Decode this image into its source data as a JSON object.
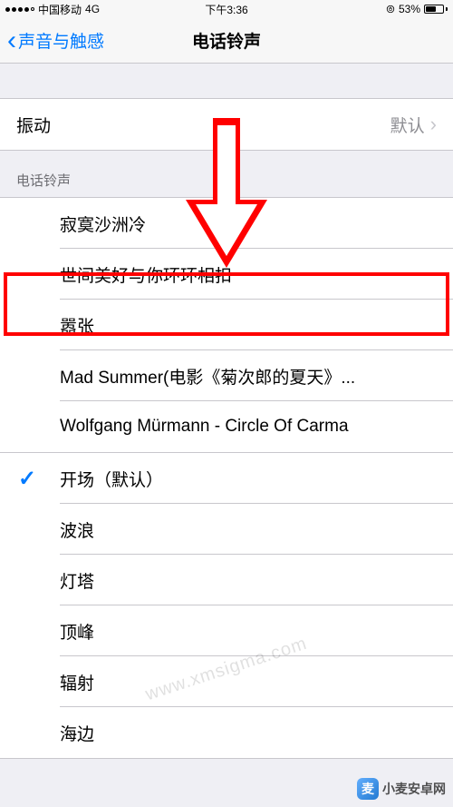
{
  "status": {
    "carrier": "中国移动",
    "network": "4G",
    "time": "下午3:36",
    "battery_pct": "53%"
  },
  "nav": {
    "back_label": "声音与触感",
    "title": "电话铃声"
  },
  "vibration": {
    "label": "振动",
    "value": "默认"
  },
  "ringtone_header": "电话铃声",
  "custom_tones": [
    {
      "label": "寂寞沙洲冷"
    },
    {
      "label": "世间美好与你环环相扣"
    },
    {
      "label": "嚣张"
    },
    {
      "label": "Mad Summer(电影《菊次郎的夏天》..."
    },
    {
      "label": "Wolfgang Mürmann - Circle Of Carma"
    }
  ],
  "system_tones": [
    {
      "label": "开场（默认）",
      "checked": true
    },
    {
      "label": "波浪"
    },
    {
      "label": "灯塔"
    },
    {
      "label": "顶峰"
    },
    {
      "label": "辐射"
    },
    {
      "label": "海边"
    }
  ],
  "watermark": {
    "site": "小麦安卓网",
    "url": "www.xmsigma.com"
  }
}
